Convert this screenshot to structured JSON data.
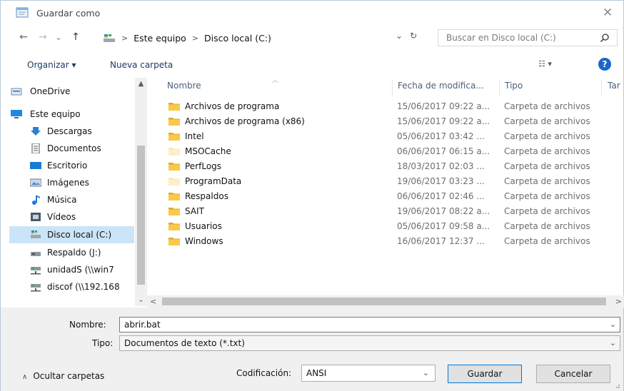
{
  "window": {
    "title": "Guardar como",
    "close_glyph": "✕"
  },
  "nav": {
    "back_glyph": "←",
    "forward_glyph": "→",
    "recent_glyph": "⌄",
    "up_glyph": "↑",
    "breadcrumb": [
      "Este equipo",
      "Disco local (C:)"
    ],
    "sep_glyph": ">",
    "dropdown_glyph": "⌄",
    "refresh_glyph": "↻",
    "search_placeholder": "Buscar en Disco local (C:)"
  },
  "commands": {
    "organize": "Organizar ▾",
    "new_folder": "Nueva carpeta",
    "view": "☷ ▾",
    "help": "?"
  },
  "sidebar": {
    "items": [
      {
        "label": "OneDrive",
        "icon": "onedrive-icon"
      },
      {
        "label": "Este equipo",
        "icon": "computer-icon"
      },
      {
        "label": "Descargas",
        "icon": "download-icon"
      },
      {
        "label": "Documentos",
        "icon": "document-icon"
      },
      {
        "label": "Escritorio",
        "icon": "desktop-icon"
      },
      {
        "label": "Imágenes",
        "icon": "image-icon"
      },
      {
        "label": "Música",
        "icon": "music-icon"
      },
      {
        "label": "Vídeos",
        "icon": "video-icon"
      },
      {
        "label": "Disco local (C:)",
        "icon": "drive-icon"
      },
      {
        "label": "Respaldo (J:)",
        "icon": "drive-icon"
      },
      {
        "label": "unidadS (\\\\win7",
        "icon": "network-drive-icon"
      },
      {
        "label": "discof (\\\\192.168",
        "icon": "network-drive-icon"
      }
    ],
    "selected": "Disco local (C:)"
  },
  "columns": {
    "name": "Nombre",
    "date": "Fecha de modifica...",
    "type": "Tipo",
    "size": "Tar"
  },
  "files": [
    {
      "name": "Archivos de programa",
      "date": "15/06/2017 09:22 a...",
      "type": "Carpeta de archivos"
    },
    {
      "name": "Archivos de programa (x86)",
      "date": "15/06/2017 09:22 a...",
      "type": "Carpeta de archivos"
    },
    {
      "name": "Intel",
      "date": "05/06/2017 03:42 ...",
      "type": "Carpeta de archivos"
    },
    {
      "name": "MSOCache",
      "date": "06/06/2017 06:15 a...",
      "type": "Carpeta de archivos"
    },
    {
      "name": "PerfLogs",
      "date": "18/03/2017 02:03 ...",
      "type": "Carpeta de archivos"
    },
    {
      "name": "ProgramData",
      "date": "19/06/2017 03:23 ...",
      "type": "Carpeta de archivos"
    },
    {
      "name": "Respaldos",
      "date": "06/06/2017 02:46 ...",
      "type": "Carpeta de archivos"
    },
    {
      "name": "SAIT",
      "date": "19/06/2017 08:22 a...",
      "type": "Carpeta de archivos"
    },
    {
      "name": "Usuarios",
      "date": "05/06/2017 09:58 a...",
      "type": "Carpeta de archivos"
    },
    {
      "name": "Windows",
      "date": "16/06/2017 12:37 ...",
      "type": "Carpeta de archivos"
    }
  ],
  "form": {
    "name_label": "Nombre:",
    "name_value": "abrir.bat",
    "type_label": "Tipo:",
    "type_value": "Documentos de texto (*.txt)",
    "encoding_label": "Codificación:",
    "encoding_value": "ANSI",
    "dropdown_glyph": "⌄"
  },
  "buttons": {
    "save": "Guardar",
    "cancel": "Cancelar"
  },
  "footer": {
    "hide_folders": "Ocultar carpetas",
    "chevron_glyph": "∧"
  },
  "scroll": {
    "up_glyph": "▲",
    "down_glyph": "⌄",
    "left_glyph": "<",
    "right_glyph": ">"
  },
  "colors": {
    "selection": "#cce4f7",
    "folder": "#f8c94a",
    "accent": "#0078d7"
  }
}
